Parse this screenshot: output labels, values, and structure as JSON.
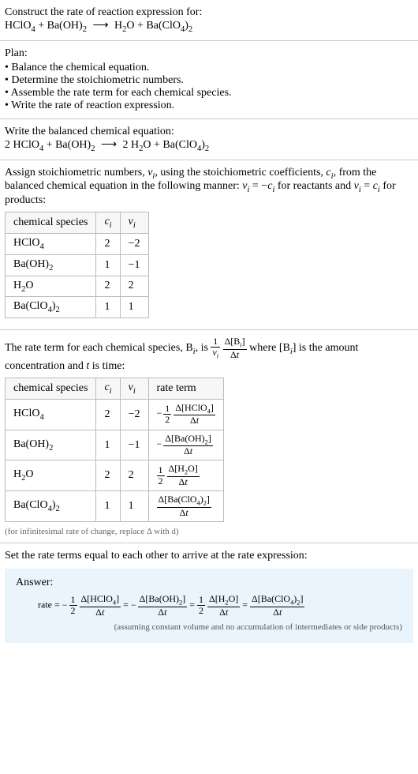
{
  "intro": {
    "prompt": "Construct the rate of reaction expression for:",
    "equation_lhs1": "HClO",
    "equation_lhs1_sub": "4",
    "equation_plus1": " + ",
    "equation_lhs2": "Ba(OH)",
    "equation_lhs2_sub": "2",
    "equation_arrow": "⟶",
    "equation_rhs1": "H",
    "equation_rhs1_sub": "2",
    "equation_rhs1b": "O + Ba(ClO",
    "equation_rhs1b_sub": "4",
    "equation_rhs1c": ")",
    "equation_rhs1c_sub": "2"
  },
  "plan": {
    "title": "Plan:",
    "items": [
      "Balance the chemical equation.",
      "Determine the stoichiometric numbers.",
      "Assemble the rate term for each chemical species.",
      "Write the rate of reaction expression."
    ]
  },
  "balanced": {
    "title": "Write the balanced chemical equation:",
    "c1": "2 HClO",
    "c1_sub": "4",
    "plus1": " + Ba(OH)",
    "plus1_sub": "2",
    "arrow": "⟶",
    "c2": "2 H",
    "c2_sub": "2",
    "c2b": "O + Ba(ClO",
    "c2b_sub": "4",
    "c2c": ")",
    "c2c_sub": "2"
  },
  "assign": {
    "text1": "Assign stoichiometric numbers, ",
    "nu": "ν",
    "sub_i": "i",
    "text2": ", using the stoichiometric coefficients, ",
    "c": "c",
    "text3": ", from the balanced chemical equation in the following manner: ",
    "eq1a": "ν",
    "eq1b": " = −",
    "eq1c": "c",
    "text4": " for reactants and ",
    "eq2a": "ν",
    "eq2b": " = ",
    "eq2c": "c",
    "text5": " for products:"
  },
  "table1": {
    "h1": "chemical species",
    "h2": "c",
    "h2_sub": "i",
    "h3": "ν",
    "h3_sub": "i",
    "rows": [
      {
        "sp": "HClO",
        "sp_sub": "4",
        "c": "2",
        "nu": "−2"
      },
      {
        "sp": "Ba(OH)",
        "sp_sub": "2",
        "c": "1",
        "nu": "−1"
      },
      {
        "sp": "H",
        "sp_sub": "2",
        "sp2": "O",
        "c": "2",
        "nu": "2"
      },
      {
        "sp": "Ba(ClO",
        "sp_sub": "4",
        "sp2": ")",
        "sp2_sub": "2",
        "c": "1",
        "nu": "1"
      }
    ]
  },
  "rateterm": {
    "text1": "The rate term for each chemical species, B",
    "sub_i": "i",
    "text2": ", is ",
    "frac1_num": "1",
    "frac1_den_a": "ν",
    "frac1_den_sub": "i",
    "frac2_num": "Δ[B",
    "frac2_num_sub": "i",
    "frac2_num_b": "]",
    "frac2_den": "Δt",
    "text3": " where [B",
    "text4": "] is the amount concentration and ",
    "t": "t",
    "text5": " is time:"
  },
  "table2": {
    "h1": "chemical species",
    "h2": "c",
    "h2_sub": "i",
    "h3": "ν",
    "h3_sub": "i",
    "h4": "rate term"
  },
  "note": "(for infinitesimal rate of change, replace Δ with d)",
  "final": {
    "title": "Set the rate terms equal to each other to arrive at the rate expression:"
  },
  "answer": {
    "label": "Answer:",
    "rate": "rate = ",
    "note": "(assuming constant volume and no accumulation of intermediates or side products)"
  }
}
